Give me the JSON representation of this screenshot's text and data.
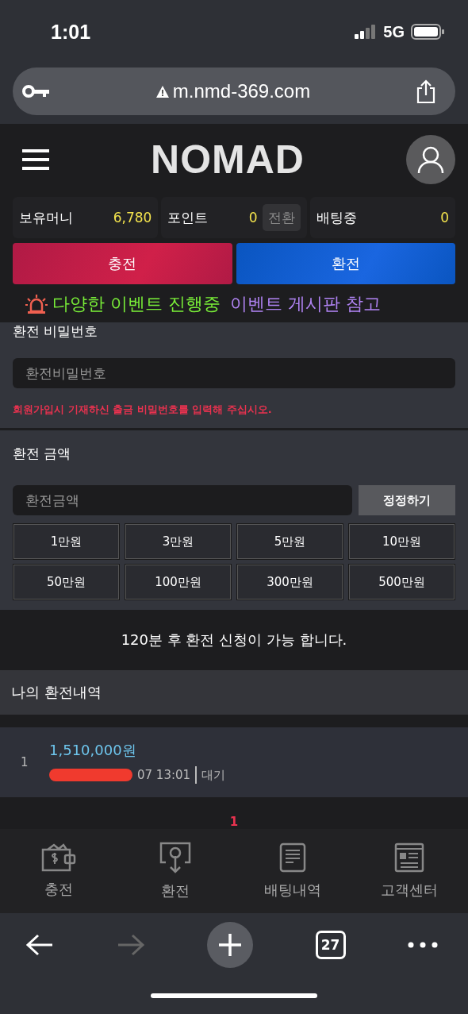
{
  "status_bar": {
    "time": "1:01",
    "network": "5G"
  },
  "address_bar": {
    "url": "m.nmd-369.com"
  },
  "header": {
    "logo": "NOMAD"
  },
  "stats": [
    {
      "label": "보유머니",
      "value": "6,780"
    },
    {
      "label": "포인트",
      "value": "0",
      "action": "전환"
    },
    {
      "label": "배팅중",
      "value": "0"
    }
  ],
  "main_buttons": [
    {
      "label": "충전",
      "kind": "deposit"
    },
    {
      "label": "환전",
      "kind": "withdraw"
    }
  ],
  "event_banner": {
    "text": "다양한 이벤트 진행중",
    "link": "이벤트 게시판 참고"
  },
  "password_section": {
    "title": "환전 비밀번호",
    "placeholder": "환전비밀번호",
    "hint": "회원가입시 기재하신 출금 비밀번호를 입력해 주십시오."
  },
  "amount_section": {
    "title": "환전 금액",
    "placeholder": "환전금액",
    "reset_button": "정정하기",
    "amounts": [
      "1만원",
      "3만원",
      "5만원",
      "10만원",
      "50만원",
      "100만원",
      "300만원",
      "500만원"
    ]
  },
  "notice": "120분 후 환전 신청이 가능 합니다.",
  "history": {
    "title": "나의 환전내역",
    "rows": [
      {
        "index": "1",
        "amount": "1,510,000원",
        "date": "07 13:01",
        "status": "대기"
      }
    ]
  },
  "pagination": [
    {
      "label": "1",
      "selected": true
    }
  ],
  "bottom_nav": [
    {
      "label": "충전",
      "kind": "wallet"
    },
    {
      "label": "환전",
      "kind": "exchange"
    },
    {
      "label": "배팅내역",
      "kind": "document"
    },
    {
      "label": "고객센터",
      "kind": "news"
    }
  ],
  "browser_toolbar": {
    "tab_count": "27"
  }
}
